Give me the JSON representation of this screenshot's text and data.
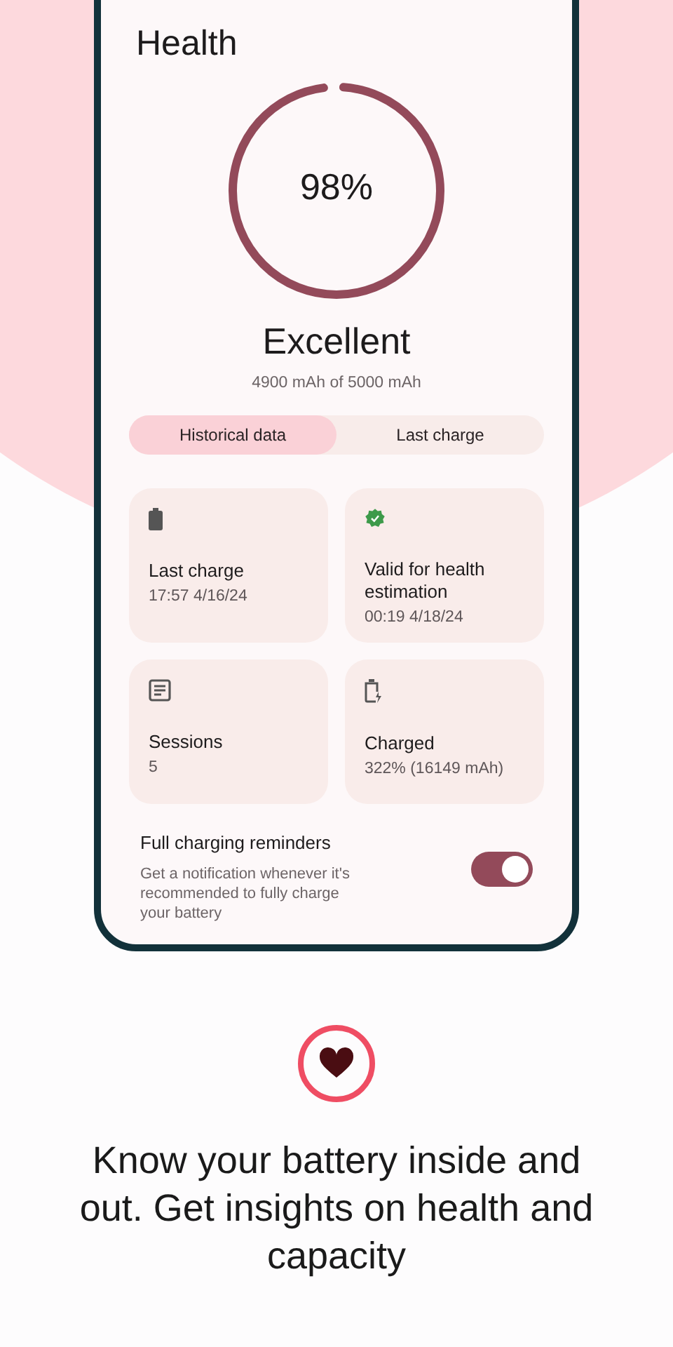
{
  "screen": {
    "title": "Health",
    "gauge": {
      "level": 0.98,
      "reading": "98%"
    },
    "rating": "Excellent",
    "capacity": "4900 mAh of 5000 mAh",
    "tabs": [
      {
        "label": "Historical data",
        "selected": true
      },
      {
        "label": "Last charge",
        "selected": false
      }
    ],
    "cards": [
      {
        "kind": "battery",
        "title": "Last charge",
        "value": "17:57 4/16/24"
      },
      {
        "kind": "verified",
        "title": "Valid for health estimation",
        "value": "00:19 4/18/24"
      },
      {
        "kind": "notes",
        "title": "Sessions",
        "value": "5"
      },
      {
        "kind": "charging",
        "title": "Charged",
        "value": "322% (16149 mAh)"
      }
    ],
    "reminder": {
      "title": "Full charging reminders",
      "description": "Get a notification whenever it's recommended to fully charge your battery",
      "on": true
    }
  },
  "tagline": "Know your battery inside and out. Get insights on health and capacity"
}
